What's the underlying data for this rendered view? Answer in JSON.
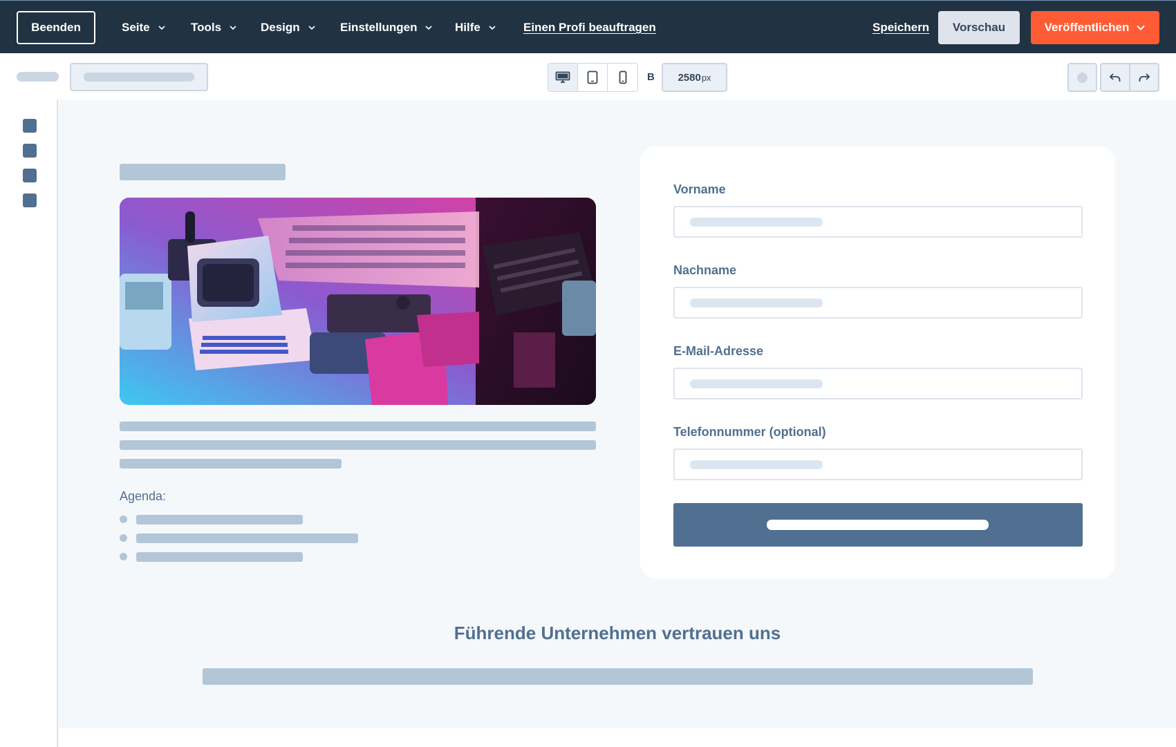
{
  "topbar": {
    "exit_label": "Beenden",
    "menus": [
      {
        "label": "Seite"
      },
      {
        "label": "Tools"
      },
      {
        "label": "Design"
      },
      {
        "label": "Einstellungen"
      },
      {
        "label": "Hilfe"
      }
    ],
    "hire_link": "Einen Profi beauftragen",
    "save_label": "Speichern",
    "preview_label": "Vorschau",
    "publish_label": "Veröffentlichen"
  },
  "toolbar": {
    "devices": [
      "desktop-icon",
      "tablet-icon",
      "mobile-icon"
    ],
    "active_device": "desktop",
    "width_prefix": "B",
    "width_value": "2580",
    "width_unit": "px"
  },
  "content": {
    "agenda_label": "Agenda:"
  },
  "form": {
    "fields": [
      {
        "label": "Vorname"
      },
      {
        "label": "Nachname"
      },
      {
        "label": "E-Mail-Adresse"
      },
      {
        "label": "Telefonnummer (optional)"
      }
    ]
  },
  "trust": {
    "title": "Führende Unternehmen vertrauen uns"
  },
  "colors": {
    "nav_bg": "#213343",
    "publish": "#ff5c35",
    "submit": "#516f90",
    "placeholder": "#b3c6d7"
  }
}
